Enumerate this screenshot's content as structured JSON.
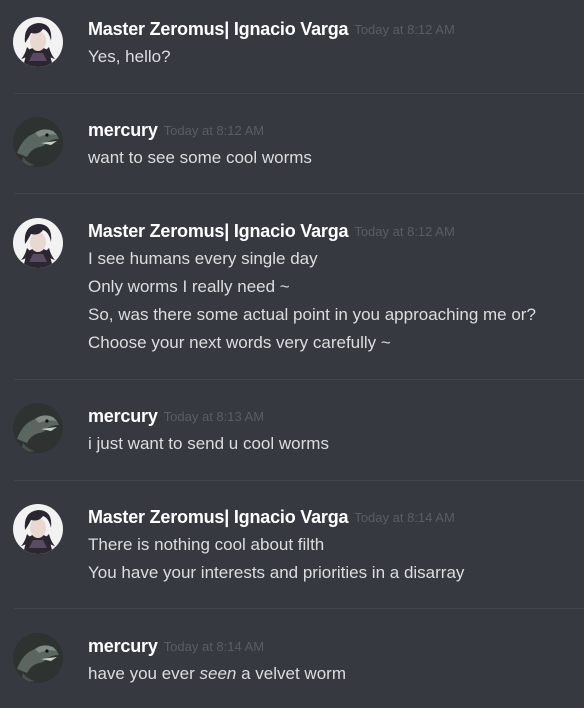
{
  "messages": [
    {
      "username": "Master Zeromus| Ignacio Varga",
      "timestamp": "Today at 8:12 AM",
      "avatar": "anime-character-avatar",
      "lines": [
        "Yes, hello?"
      ]
    },
    {
      "username": "mercury",
      "timestamp": "Today at 8:12 AM",
      "avatar": "raptor-avatar",
      "lines": [
        "want to see some cool worms"
      ]
    },
    {
      "username": "Master Zeromus| Ignacio Varga",
      "timestamp": "Today at 8:12 AM",
      "avatar": "anime-character-avatar",
      "lines": [
        "I see humans every single day",
        "Only worms I really need ~",
        "So, was there some actual point in you approaching me or?",
        "Choose your next words very carefully ~"
      ]
    },
    {
      "username": "mercury",
      "timestamp": "Today at 8:13 AM",
      "avatar": "raptor-avatar",
      "lines": [
        "i just want to send u cool worms"
      ]
    },
    {
      "username": "Master Zeromus| Ignacio Varga",
      "timestamp": "Today at 8:14 AM",
      "avatar": "anime-character-avatar",
      "lines": [
        "There is nothing cool about filth",
        "You have your interests and priorities in a disarray"
      ]
    },
    {
      "username": "mercury",
      "timestamp": "Today at 8:14 AM",
      "avatar": "raptor-avatar",
      "lines_rich": {
        "before": "have you ever ",
        "emphasis": "seen",
        "after": " a velvet worm"
      }
    }
  ],
  "colors": {
    "background": "#36393f",
    "username": "#ffffff",
    "message_text": "#dcddde",
    "timestamp": "#5a5d63",
    "divider": "#42454a"
  }
}
